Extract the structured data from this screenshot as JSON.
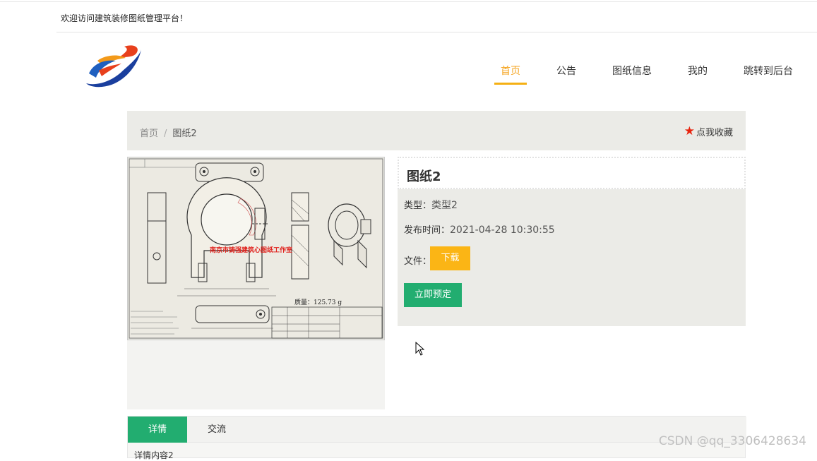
{
  "header": {
    "welcome": "欢迎访问建筑装修图纸管理平台！"
  },
  "nav": {
    "items": [
      {
        "label": "首页",
        "active": true
      },
      {
        "label": "公告",
        "active": false
      },
      {
        "label": "图纸信息",
        "active": false
      },
      {
        "label": "我的",
        "active": false
      },
      {
        "label": "跳转到后台",
        "active": false
      }
    ]
  },
  "breadcrumb": {
    "home": "首页",
    "separator": "/",
    "current": "图纸2",
    "favorite": "点我收藏",
    "favorite_icon": "star-icon"
  },
  "drawing": {
    "watermark": "南京市铸强建筑心图纸工作室",
    "mass": "质量：125.73 g"
  },
  "detail": {
    "title": "图纸2",
    "type_label": "类型：",
    "type_value": "类型2",
    "date_label": "发布时间：",
    "date_value": "2021-04-28 10:30:55",
    "file_label": "文件：",
    "download": "下载",
    "book": "立即预定"
  },
  "tabs": {
    "items": [
      "详情",
      "交流"
    ],
    "content": "详情内容2"
  },
  "watermark": "CSDN @qq_3306428634",
  "colors": {
    "accent": "#f5b014",
    "green": "#22ad70",
    "star": "#e8230d"
  }
}
